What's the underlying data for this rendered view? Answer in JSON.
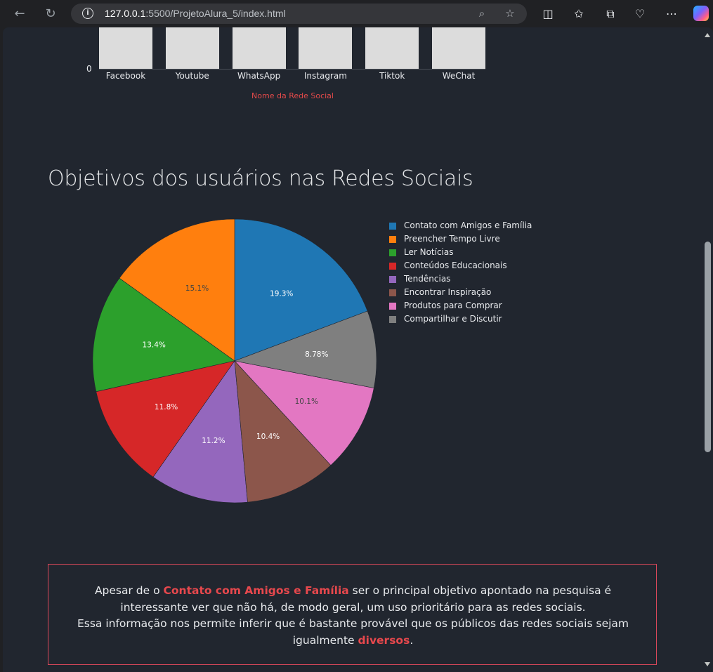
{
  "browser": {
    "url_host": "127.0.0.1",
    "url_path": ":5500/ProjetoAlura_5/index.html",
    "back_icon": "←",
    "reload_icon": "↻"
  },
  "bar_chart": {
    "categories": [
      "Facebook",
      "Youtube",
      "WhatsApp",
      "Instagram",
      "Tiktok",
      "WeChat"
    ],
    "y_tick_zero": "0",
    "xlabel": "Nome da Rede Social"
  },
  "section": {
    "title": "Objetivos dos usuários nas Redes Sociais"
  },
  "chart_data": {
    "type": "pie",
    "title": "",
    "series": [
      {
        "name": "Contato com Amigos e Família",
        "value": 19.3,
        "label": "19.3%",
        "color": "#1f77b4"
      },
      {
        "name": "Preencher Tempo Livre",
        "value": 15.1,
        "label": "15.1%",
        "color": "#ff7f0e"
      },
      {
        "name": "Ler Notícias",
        "value": 13.4,
        "label": "13.4%",
        "color": "#2ca02c"
      },
      {
        "name": "Conteúdos Educacionais",
        "value": 11.8,
        "label": "11.8%",
        "color": "#d62728"
      },
      {
        "name": "Tendências",
        "value": 11.2,
        "label": "11.2%",
        "color": "#9467bd"
      },
      {
        "name": "Encontrar Inspiração",
        "value": 10.4,
        "label": "10.4%",
        "color": "#8c564b"
      },
      {
        "name": "Produtos para Comprar",
        "value": 10.1,
        "label": "10.1%",
        "color": "#e377c2"
      },
      {
        "name": "Compartilhar e Discutir",
        "value": 8.78,
        "label": "8.78%",
        "color": "#7f7f7f"
      }
    ],
    "legend_placement": "right"
  },
  "note": {
    "part1": "Apesar de o ",
    "highlight1": "Contato com Amigos e Família",
    "part2": " ser o principal objetivo apontado na pesquisa é interessante ver que não há, de modo geral, um uso prioritário para as redes sociais.",
    "part3": "Essa informação nos permite inferir que é bastante provável que os públicos das redes sociais sejam igualmente ",
    "highlight2": "diversos",
    "part4": "."
  },
  "colors": {
    "page_bg": "#21262f",
    "accent": "#e8484d"
  }
}
